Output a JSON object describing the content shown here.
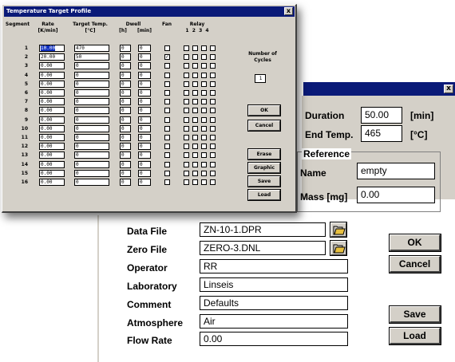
{
  "back_dialog": {
    "duration_label": "Duration",
    "duration_value": "50.00",
    "duration_unit": "[min]",
    "end_temp_label": "End Temp.",
    "end_temp_value": "465",
    "end_temp_unit": "[°C]",
    "reference_group": "Reference",
    "name_label": "Name",
    "name_value": "empty",
    "mass_label": "Mass [mg]",
    "mass_value": "0.00",
    "data_file_label": "Data File",
    "data_file_value": "ZN-10-1.DPR",
    "zero_file_label": "Zero File",
    "zero_file_value": "ZERO-3.DNL",
    "operator_label": "Operator",
    "operator_value": "RR",
    "laboratory_label": "Laboratory",
    "laboratory_value": "Linseis",
    "comment_label": "Comment",
    "comment_value": "Defaults",
    "atmosphere_label": "Atmosphere",
    "atmosphere_value": "Air",
    "flow_rate_label": "Flow Rate",
    "flow_rate_value": "0.00",
    "ok_label": "OK",
    "cancel_label": "Cancel",
    "save_label": "Save",
    "load_label": "Load",
    "close_glyph": "x"
  },
  "profile_window": {
    "title": "Temperature Target Profile",
    "close_glyph": "x",
    "headers": {
      "segment": "Segment",
      "rate": "Rate",
      "rate_unit": "[K/min]",
      "target": "Target Temp.",
      "target_unit": "[°C]",
      "dwell": "Dwell",
      "dwell_h": "[h]",
      "dwell_min": "[min]",
      "fan": "Fan",
      "relay": "Relay",
      "relay_nums": "1  2  3  4"
    },
    "cycles_label": "Number of Cycles",
    "cycles_value": "1",
    "buttons": {
      "ok": "OK",
      "cancel": "Cancel",
      "erase": "Erase",
      "graphic": "Graphic",
      "save": "Save",
      "load": "Load"
    },
    "rows": [
      {
        "seg": "1",
        "rate": "10.00",
        "target": "470",
        "dwell_h": "0",
        "dwell_min": "0",
        "fan": false
      },
      {
        "seg": "2",
        "rate": "20.00",
        "target": "50",
        "dwell_h": "0",
        "dwell_min": "0",
        "fan": true
      },
      {
        "seg": "3",
        "rate": "0.00",
        "target": "0",
        "dwell_h": "0",
        "dwell_min": "0",
        "fan": false
      },
      {
        "seg": "4",
        "rate": "0.00",
        "target": "0",
        "dwell_h": "0",
        "dwell_min": "0",
        "fan": false
      },
      {
        "seg": "5",
        "rate": "0.00",
        "target": "0",
        "dwell_h": "0",
        "dwell_min": "0",
        "fan": false
      },
      {
        "seg": "6",
        "rate": "0.00",
        "target": "0",
        "dwell_h": "0",
        "dwell_min": "0",
        "fan": false
      },
      {
        "seg": "7",
        "rate": "0.00",
        "target": "0",
        "dwell_h": "0",
        "dwell_min": "0",
        "fan": false
      },
      {
        "seg": "8",
        "rate": "0.00",
        "target": "0",
        "dwell_h": "0",
        "dwell_min": "0",
        "fan": false
      },
      {
        "seg": "9",
        "rate": "0.00",
        "target": "0",
        "dwell_h": "0",
        "dwell_min": "0",
        "fan": false
      },
      {
        "seg": "10",
        "rate": "0.00",
        "target": "0",
        "dwell_h": "0",
        "dwell_min": "0",
        "fan": false
      },
      {
        "seg": "11",
        "rate": "0.00",
        "target": "0",
        "dwell_h": "0",
        "dwell_min": "0",
        "fan": false
      },
      {
        "seg": "12",
        "rate": "0.00",
        "target": "0",
        "dwell_h": "0",
        "dwell_min": "0",
        "fan": false
      },
      {
        "seg": "13",
        "rate": "0.00",
        "target": "0",
        "dwell_h": "0",
        "dwell_min": "0",
        "fan": false
      },
      {
        "seg": "14",
        "rate": "0.00",
        "target": "0",
        "dwell_h": "0",
        "dwell_min": "0",
        "fan": false
      },
      {
        "seg": "15",
        "rate": "0.00",
        "target": "0",
        "dwell_h": "0",
        "dwell_min": "0",
        "fan": false
      },
      {
        "seg": "16",
        "rate": "0.00",
        "target": "0",
        "dwell_h": "0",
        "dwell_min": "0",
        "fan": false
      }
    ]
  }
}
